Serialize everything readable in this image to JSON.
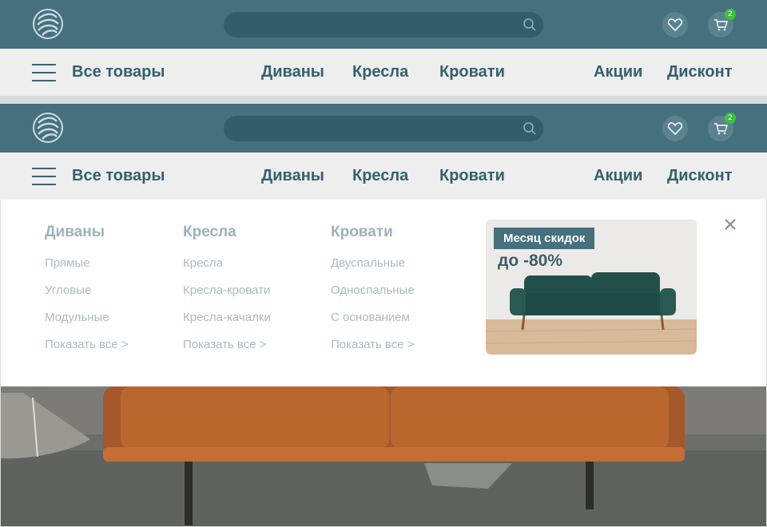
{
  "header": {
    "logo": "logo-icon",
    "search": {
      "placeholder": "",
      "icon": "search-icon"
    },
    "favorites": {
      "icon": "heart-icon"
    },
    "cart": {
      "icon": "cart-icon",
      "count": "2"
    }
  },
  "nav": {
    "all_products": "Все товары",
    "items": [
      "Диваны",
      "Кресла",
      "Кровати",
      "Акции",
      "Дисконт"
    ]
  },
  "dropdown": {
    "columns": [
      {
        "title": "Диваны",
        "links": [
          "Прямые",
          "Угловые",
          "Модульные",
          "Показать все >"
        ]
      },
      {
        "title": "Кресла",
        "links": [
          "Кресла",
          "Кресла-кровати",
          "Кресла-качалки",
          "Показать все >"
        ]
      },
      {
        "title": "Кровати",
        "links": [
          "Двуспальные",
          "Односпальные",
          "С основанием",
          "Показать все >"
        ]
      }
    ],
    "promo": {
      "tag": "Месяц скидок",
      "discount": "до -80%"
    },
    "close_icon": "close-icon"
  },
  "colors": {
    "header": "#46707e",
    "navbar": "#eeeeee",
    "nav_text": "#34606e",
    "badge": "#3fbf3f"
  }
}
